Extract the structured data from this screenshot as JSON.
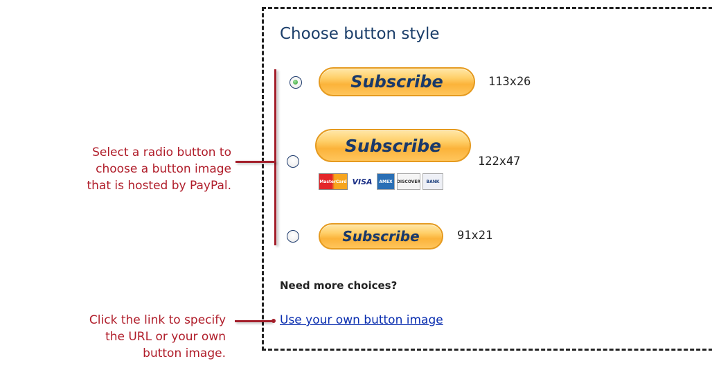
{
  "panel": {
    "title": "Choose button style",
    "options": [
      {
        "button_label": "Subscribe",
        "dimensions": "113x26",
        "selected": true
      },
      {
        "button_label": "Subscribe",
        "dimensions": "122x47",
        "selected": false,
        "card_logos": [
          "MasterCard",
          "VISA",
          "AMEX",
          "DISCOVER",
          "BANK"
        ]
      },
      {
        "button_label": "Subscribe",
        "dimensions": "91x21",
        "selected": false
      }
    ],
    "more_choices_label": "Need more choices?",
    "own_image_link": "Use your own button image"
  },
  "annotations": {
    "radio_help": [
      "Select a radio button to",
      "choose a button image",
      "that is hosted by PayPal."
    ],
    "link_help": [
      "Click the link to specify",
      "the URL or your own",
      "button image."
    ]
  },
  "colors": {
    "annotation": "#b01d2a",
    "bracket": "#a31e2a",
    "title": "#1b3e6a",
    "link": "#0b2fb0",
    "button_border": "#e59a1f"
  }
}
